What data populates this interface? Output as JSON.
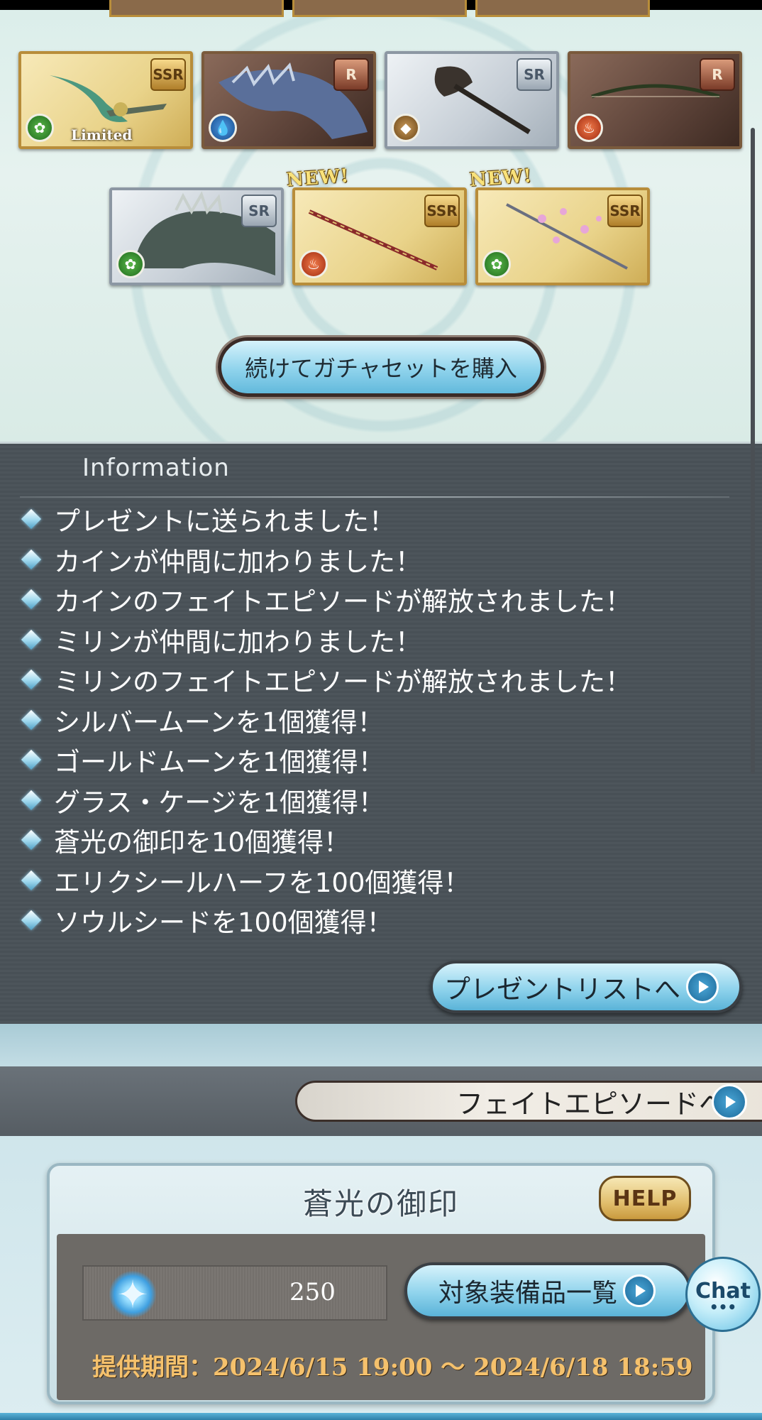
{
  "gacha": {
    "cards": [
      {
        "rarity": "SSR",
        "element": "wind",
        "label": "Limited",
        "new": false
      },
      {
        "rarity": "R",
        "element": "water",
        "label": "",
        "new": false
      },
      {
        "rarity": "SR",
        "element": "earth",
        "label": "",
        "new": false
      },
      {
        "rarity": "R",
        "element": "fire",
        "label": "",
        "new": false
      },
      {
        "rarity": "SR",
        "element": "wind",
        "label": "",
        "new": false
      },
      {
        "rarity": "SSR",
        "element": "fire",
        "label": "",
        "new": true
      },
      {
        "rarity": "SSR",
        "element": "wind",
        "label": "",
        "new": true
      }
    ],
    "new_label": "NEW!",
    "buy_again_label": "続けてガチャセットを購入"
  },
  "information": {
    "title": "Information",
    "items": [
      "プレゼントに送られました！",
      "カインが仲間に加わりました！",
      "カインのフェイトエピソードが解放されました！",
      "ミリンが仲間に加わりました！",
      "ミリンのフェイトエピソードが解放されました！",
      "シルバームーンを1個獲得！",
      "ゴールドムーンを1個獲得！",
      "グラス・ケージを1個獲得！",
      "蒼光の御印を10個獲得！",
      "エリクシールハーフを100個獲得！",
      "ソウルシードを100個獲得！"
    ],
    "present_list_label": "プレゼントリストへ"
  },
  "fate_episode": {
    "label": "フェイトエピソードへ"
  },
  "seal": {
    "title": "蒼光の御印",
    "help_label": "HELP",
    "count": "250",
    "target_equipment_label": "対象装備品一覧",
    "period_label": "提供期間：",
    "period_value": "2024/6/15 19:00 〜 2024/6/18 18:59"
  },
  "chat": {
    "label": "Chat",
    "dots": "•••"
  }
}
